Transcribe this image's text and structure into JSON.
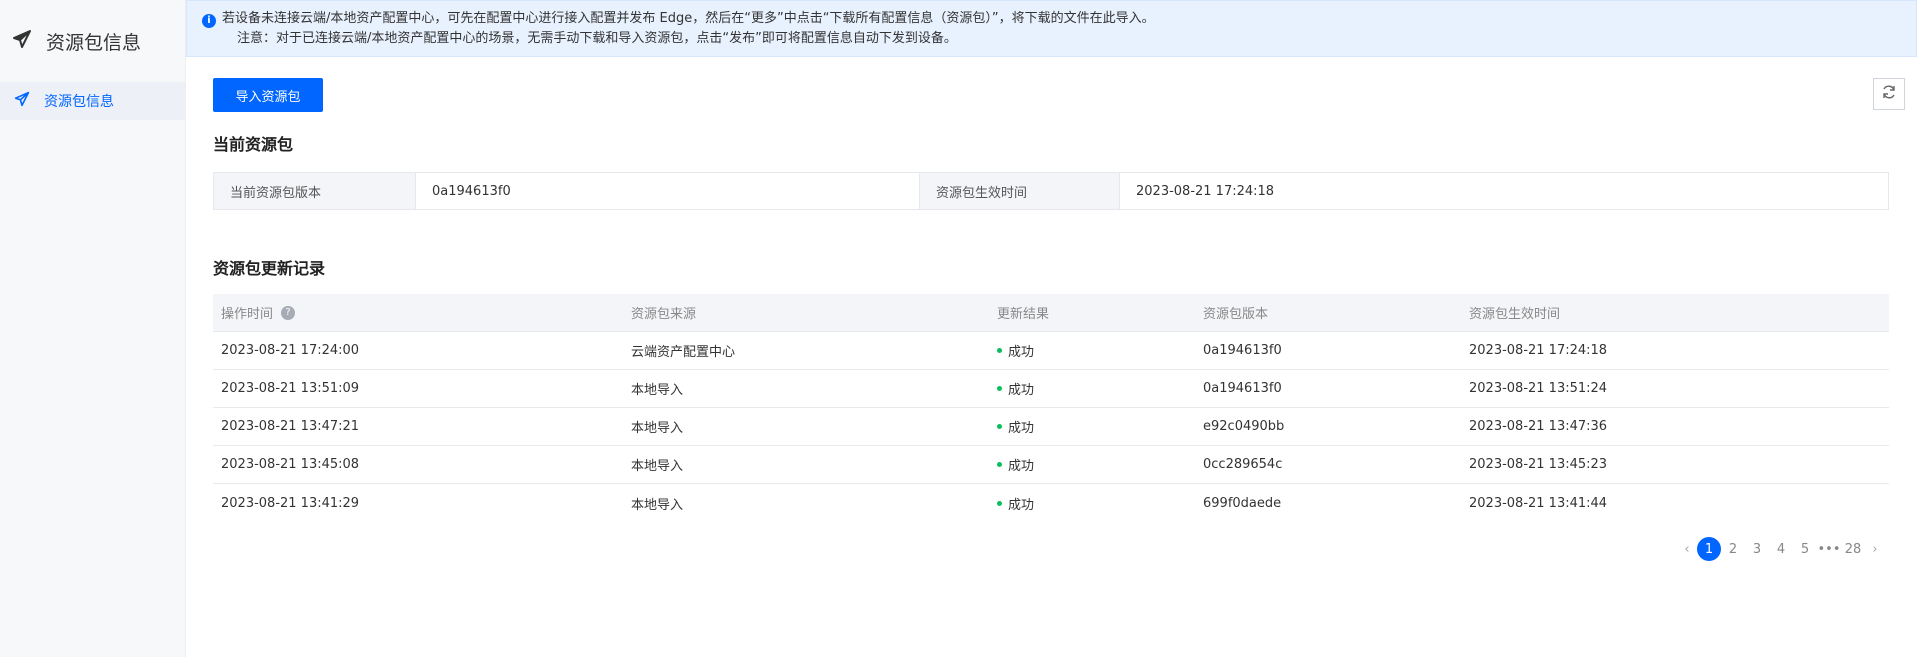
{
  "sidebar": {
    "title": "资源包信息",
    "items": [
      {
        "label": "资源包信息"
      }
    ]
  },
  "notice": {
    "line1": "若设备未连接云端/本地资产配置中心，可先在配置中心进行接入配置并发布 Edge，然后在“更多”中点击“下载所有配置信息（资源包）”，将下载的文件在此导入。",
    "line2": "注意：对于已连接云端/本地资产配置中心的场景，无需手动下载和导入资源包，点击“发布”即可将配置信息自动下发到设备。"
  },
  "toolbar": {
    "import_label": "导入资源包"
  },
  "current": {
    "section_title": "当前资源包",
    "version_label": "当前资源包版本",
    "version_value": "0a194613f0",
    "effective_label": "资源包生效时间",
    "effective_value": "2023-08-21 17:24:18"
  },
  "records": {
    "section_title": "资源包更新记录",
    "headers": [
      "操作时间",
      "资源包来源",
      "更新结果",
      "资源包版本",
      "资源包生效时间"
    ],
    "rows": [
      {
        "time": "2023-08-21 17:24:00",
        "source": "云端资产配置中心",
        "result": "成功",
        "version": "0a194613f0",
        "effective": "2023-08-21 17:24:18"
      },
      {
        "time": "2023-08-21 13:51:09",
        "source": "本地导入",
        "result": "成功",
        "version": "0a194613f0",
        "effective": "2023-08-21 13:51:24"
      },
      {
        "time": "2023-08-21 13:47:21",
        "source": "本地导入",
        "result": "成功",
        "version": "e92c0490bb",
        "effective": "2023-08-21 13:47:36"
      },
      {
        "time": "2023-08-21 13:45:08",
        "source": "本地导入",
        "result": "成功",
        "version": "0cc289654c",
        "effective": "2023-08-21 13:45:23"
      },
      {
        "time": "2023-08-21 13:41:29",
        "source": "本地导入",
        "result": "成功",
        "version": "699f0daede",
        "effective": "2023-08-21 13:41:44"
      }
    ]
  },
  "pagination": {
    "pages": [
      "1",
      "2",
      "3",
      "4",
      "5"
    ],
    "ellipsis": "•••",
    "last": "28",
    "current": "1"
  },
  "colors": {
    "accent": "#0066ff",
    "success": "#0abf5b"
  }
}
